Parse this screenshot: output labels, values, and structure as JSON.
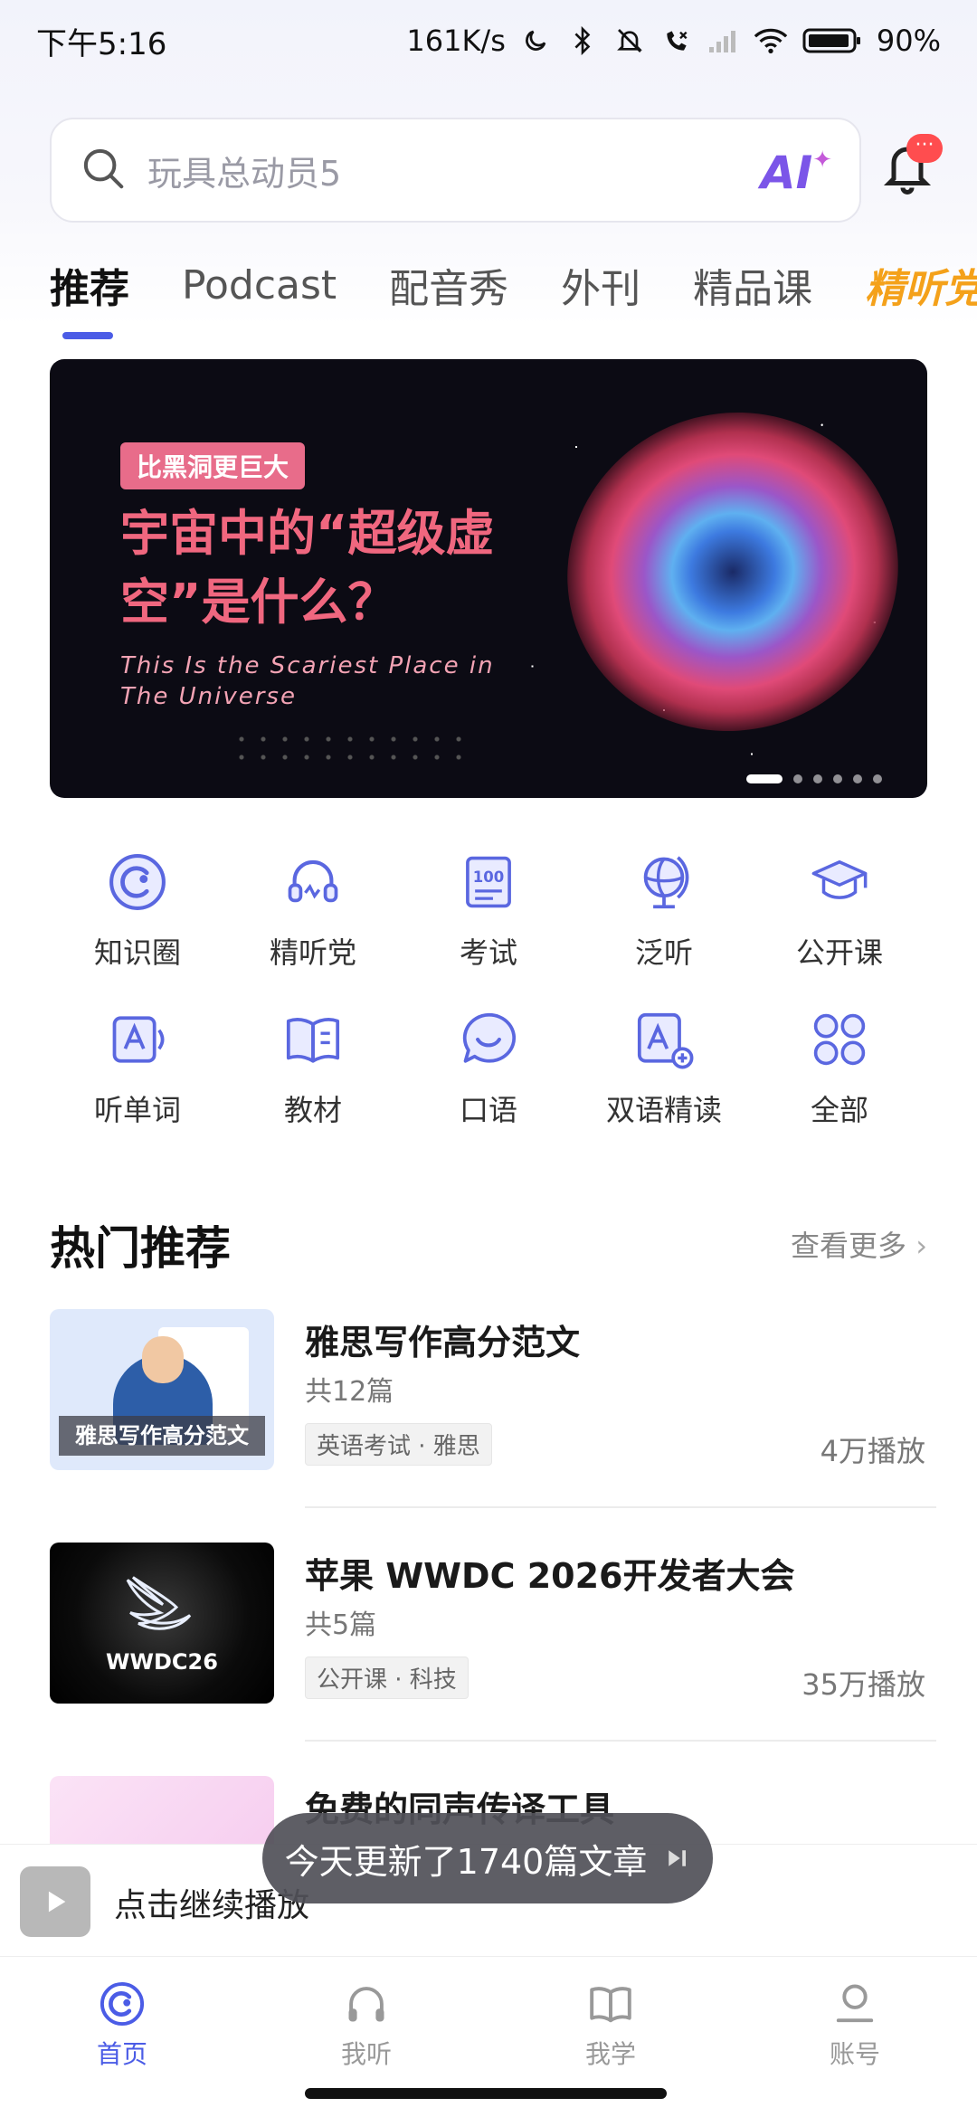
{
  "status_bar": {
    "time": "下午5:16",
    "net_speed": "161K/s",
    "battery": "90%"
  },
  "search": {
    "placeholder": "玩具总动员5",
    "ai_label": "AI",
    "notification_badge": "···"
  },
  "tabs": [
    "推荐",
    "Podcast",
    "配音秀",
    "外刊",
    "精品课",
    "精听党"
  ],
  "banner": {
    "tag": "比黑洞更巨大",
    "headline": "宇宙中的“超级虚空”是什么？",
    "subtitle": "This Is the Scariest Place in The Universe",
    "slides": 6,
    "current_slide": 1
  },
  "shortcuts": [
    {
      "label": "知识圈",
      "icon": "circle-c-icon"
    },
    {
      "label": "精听党",
      "icon": "headset-icon"
    },
    {
      "label": "考试",
      "icon": "exam-100-icon"
    },
    {
      "label": "泛听",
      "icon": "globe-icon"
    },
    {
      "label": "公开课",
      "icon": "graduation-cap-icon"
    },
    {
      "label": "听单词",
      "icon": "word-card-icon"
    },
    {
      "label": "教材",
      "icon": "book-icon"
    },
    {
      "label": "口语",
      "icon": "chat-bubble-icon"
    },
    {
      "label": "双语精读",
      "icon": "bilingual-read-icon"
    },
    {
      "label": "全部",
      "icon": "grid-all-icon"
    }
  ],
  "hot": {
    "title": "热门推荐",
    "more": "查看更多",
    "items": [
      {
        "title": "雅思写作高分范文",
        "count": "共12篇",
        "tag": "英语考试 · 雅思",
        "plays": "4万播放",
        "thumb_caption": "雅思写作高分范文"
      },
      {
        "title": "苹果 WWDC 2026开发者大会",
        "count": "共5篇",
        "tag": "公开课 · 科技",
        "plays": "35万播放",
        "thumb_caption": "WWDC26"
      },
      {
        "title": "免费的同声传译工具",
        "count": "",
        "tag": "",
        "plays": "",
        "thumb_caption": ""
      }
    ]
  },
  "player": {
    "text": "点击继续播放"
  },
  "toast": {
    "text": "今天更新了1740篇文章"
  },
  "bottom_nav": [
    {
      "label": "首页",
      "icon": "home-icon",
      "active": true
    },
    {
      "label": "我听",
      "icon": "headphones-icon",
      "active": false
    },
    {
      "label": "我学",
      "icon": "open-book-icon",
      "active": false
    },
    {
      "label": "账号",
      "icon": "account-icon",
      "active": false
    }
  ],
  "colors": {
    "accent": "#4b5ce6",
    "icon_blue": "#5a67e0",
    "brand_orange": "#f4a11a"
  }
}
